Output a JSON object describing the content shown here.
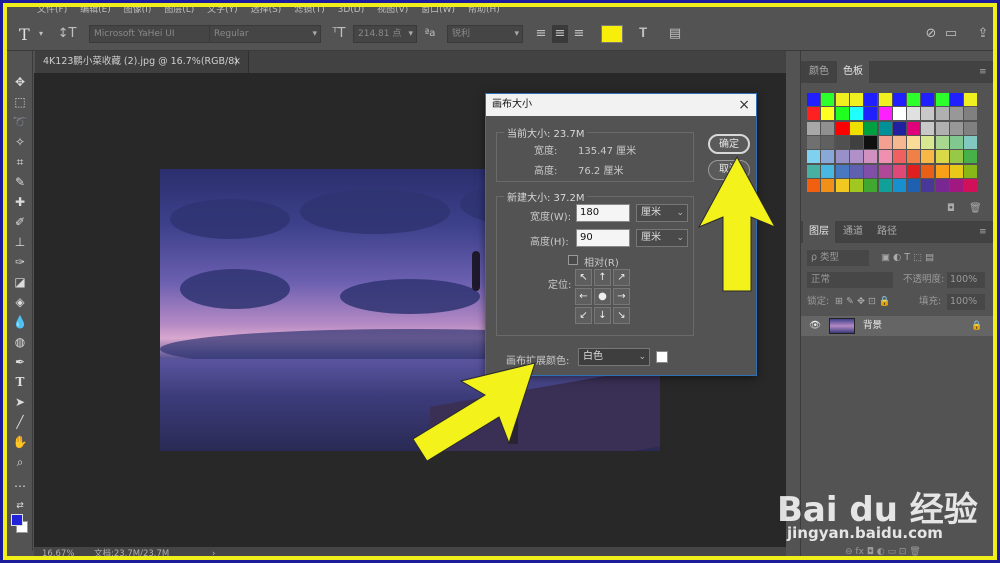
{
  "menu": [
    "文件(F)",
    "编辑(E)",
    "图像(I)",
    "图层(L)",
    "文字(Y)",
    "选择(S)",
    "滤镜(T)",
    "3D(D)",
    "视图(V)",
    "窗口(W)",
    "帮助(H)"
  ],
  "options_bar": {
    "tool_glyph": "T",
    "font_family": "Microsoft YaHei UI",
    "font_style": "Regular",
    "font_size": "214.81 点",
    "aa_glyph": "ªa",
    "aa_mode": "锐利",
    "color_swatch": "#f7ef0a"
  },
  "document_tab": {
    "title": "4K123鹏小菜收藏 (2).jpg @ 16.7%(RGB/8)",
    "close": "×"
  },
  "status_bar": {
    "zoom": "16.67%",
    "doc_info": "文档:23.7M/23.7M",
    "arrow": "›"
  },
  "panels": {
    "swatches_tabs": [
      "颜色",
      "色板"
    ],
    "layers_tabs": [
      "图层",
      "通道",
      "路径"
    ],
    "filter_label": "ρ 类型",
    "blend_mode": "正常",
    "opacity_label": "不透明度:",
    "opacity_value": "100%",
    "lock_label": "锁定:",
    "fill_label": "填充:",
    "fill_value": "100%",
    "layer_name": "背景",
    "bottom_icons": "⊖  fx  ◘  ◐  ▭  ⊡  🗑"
  },
  "swatch_colors": [
    [
      "#1f1fff",
      "#2cff2c",
      "#f0f020",
      "#f0f020",
      "#1f1fff",
      "#f0f020",
      "#1f1fff",
      "#2cff2c",
      "#1f1fff",
      "#2cff2c",
      "#1f1fff",
      "#f0f020"
    ],
    [
      "#ff2020",
      "#ffff20",
      "#20ff20",
      "#20ffff",
      "#2020ff",
      "#ff20ff",
      "#ffffff",
      "#e0e0e0",
      "#c8c8c8",
      "#b0b0b0",
      "#989898",
      "#808080"
    ],
    [
      "#a8a8a8",
      "#909090",
      "#ff0000",
      "#f0e000",
      "#00a040",
      "#009098",
      "#2020a0",
      "#e0007a",
      "#c8c8c8",
      "#b0b0b0",
      "#989898",
      "#808080"
    ],
    [
      "#707070",
      "#606060",
      "#505050",
      "#404040",
      "#101010",
      "#f4a090",
      "#f6b890",
      "#f8dc98",
      "#d8e890",
      "#a8d890",
      "#80c890",
      "#80c8c0"
    ],
    [
      "#80d0f0",
      "#88a8d8",
      "#9890c8",
      "#b090c8",
      "#d090c0",
      "#f090b0",
      "#f06060",
      "#f08048",
      "#f8b848",
      "#d8d848",
      "#98c848",
      "#48b048"
    ],
    [
      "#48b0a0",
      "#48b8e0",
      "#4878c0",
      "#6060b0",
      "#8050a8",
      "#b04898",
      "#e04878",
      "#e02020",
      "#e86018",
      "#f8a018",
      "#e8c818",
      "#88b818"
    ],
    [
      "#f06010",
      "#f09018",
      "#f0c820",
      "#a0c820",
      "#40a830",
      "#10a098",
      "#1890d0",
      "#2060b0",
      "#483898",
      "#782890",
      "#a01880",
      "#d01058"
    ]
  ],
  "dialog": {
    "title": "画布大小",
    "close": "×",
    "current_size_label": "当前大小: 23.7M",
    "width_label": "宽度:",
    "width_value": "135.47 厘米",
    "height_label": "高度:",
    "height_value": "76.2 厘米",
    "new_size_label": "新建大小: 37.2M",
    "new_width_label": "宽度(W):",
    "new_width_value": "180",
    "new_height_label": "高度(H):",
    "new_height_value": "90",
    "unit_width": "厘米",
    "unit_height": "厘米",
    "relative_label": "相对(R)",
    "anchor_label": "定位:",
    "anchor_glyphs": [
      "↖",
      "↑",
      "↗",
      "←",
      "●",
      "→",
      "↙",
      "↓",
      "↘"
    ],
    "ext_color_label": "画布扩展颜色:",
    "ext_color_value": "白色",
    "ok_label": "确定",
    "cancel_label": "取消"
  },
  "watermark": {
    "logo": "Bai du 经验",
    "url": "jingyan.baidu.com"
  },
  "colors": {
    "frame": "#f0ef1a",
    "arrow": "#f3f21a",
    "dialog_border": "#2f6fb3"
  }
}
